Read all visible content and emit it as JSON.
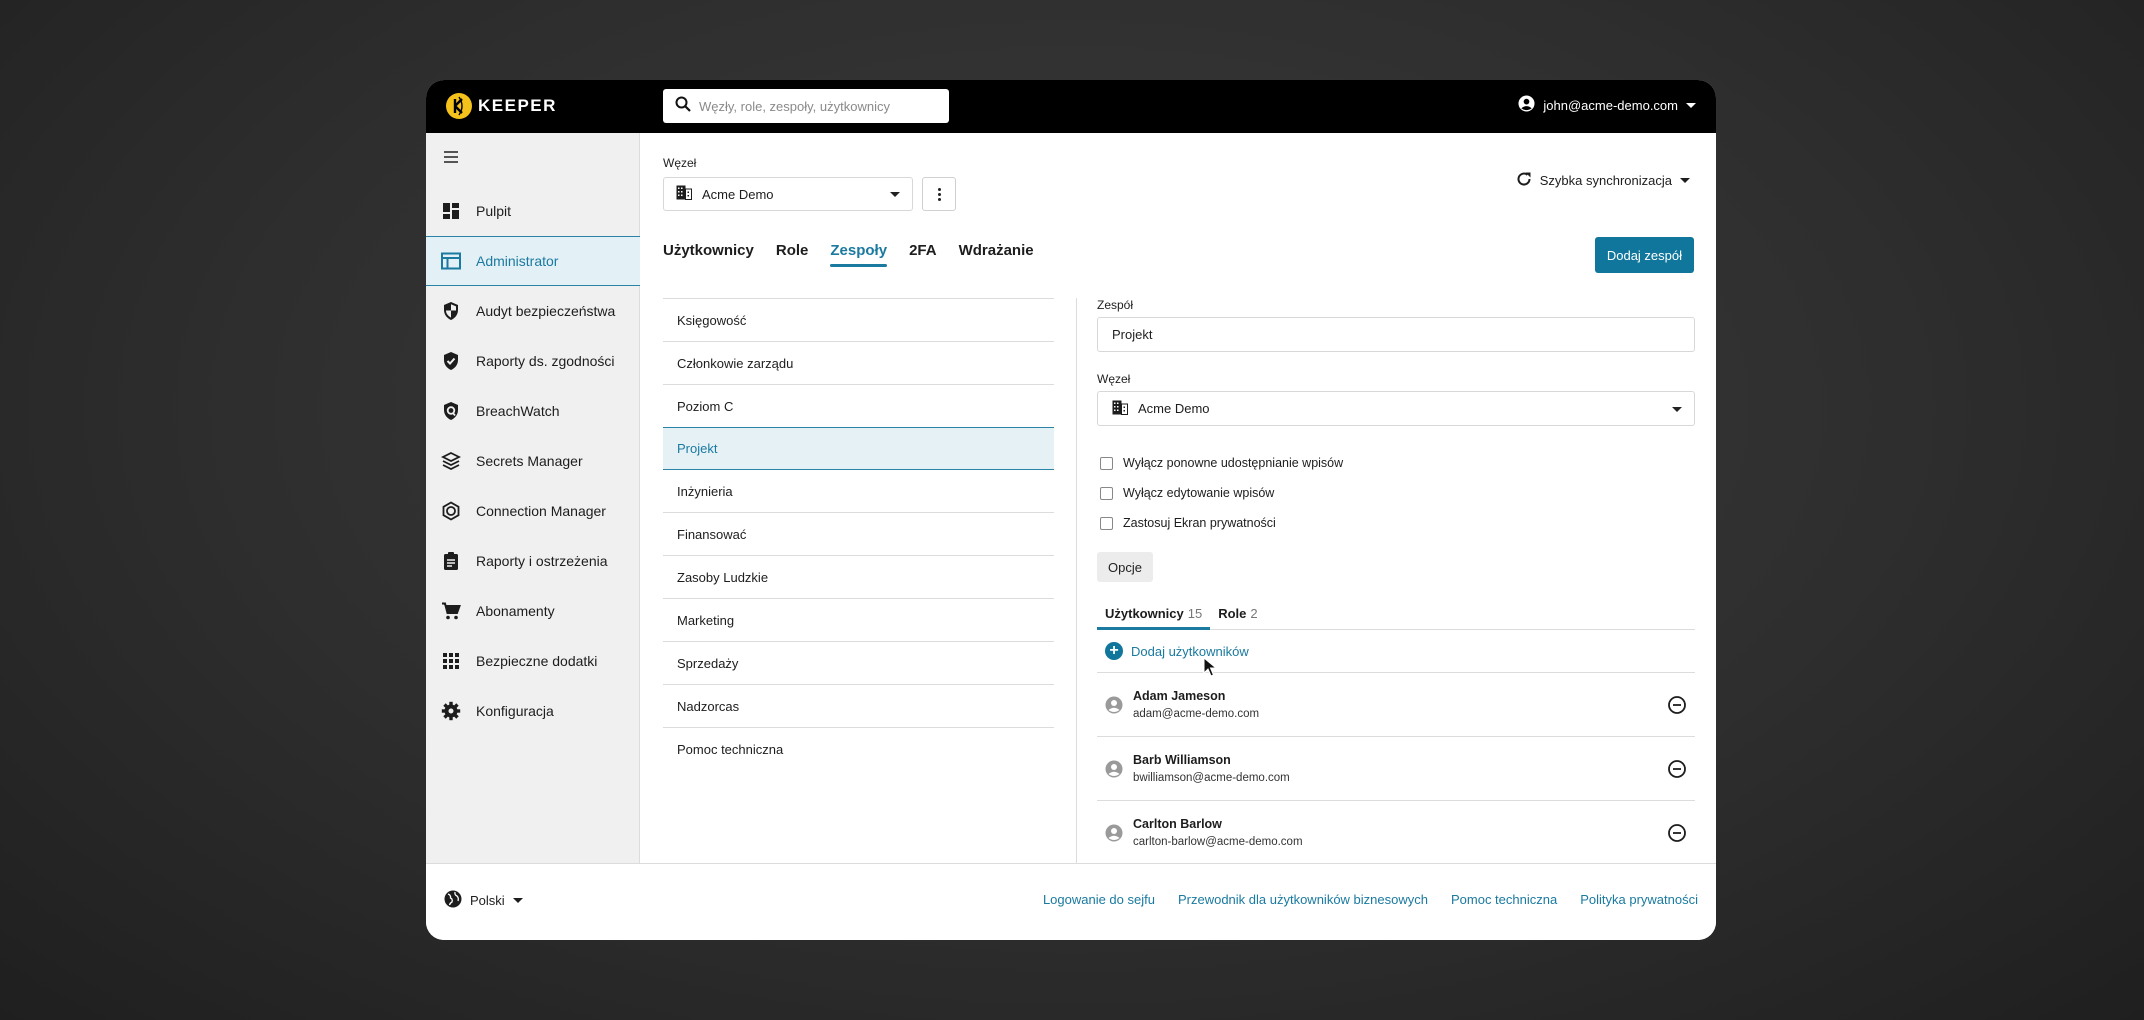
{
  "header": {
    "brand": "KEEPER",
    "search_placeholder": "Węzły, role, zespoły, użytkownicy",
    "user_email": "john@acme-demo.com"
  },
  "sidebar": {
    "items": [
      {
        "label": "Pulpit",
        "icon": "dashboard-icon"
      },
      {
        "label": "Administrator",
        "icon": "admin-console-icon",
        "active": true
      },
      {
        "label": "Audyt bezpieczeństwa",
        "icon": "shield-half-icon"
      },
      {
        "label": "Raporty ds. zgodności",
        "icon": "shield-check-icon"
      },
      {
        "label": "BreachWatch",
        "icon": "breachwatch-icon"
      },
      {
        "label": "Secrets Manager",
        "icon": "layers-icon"
      },
      {
        "label": "Connection Manager",
        "icon": "hexagon-icon"
      },
      {
        "label": "Raporty i ostrzeżenia",
        "icon": "clipboard-icon"
      },
      {
        "label": "Abonamenty",
        "icon": "cart-icon"
      },
      {
        "label": "Bezpieczne dodatki",
        "icon": "grid-icon"
      },
      {
        "label": "Konfiguracja",
        "icon": "gear-icon"
      }
    ]
  },
  "main": {
    "node_label": "Węzeł",
    "node_value": "Acme Demo",
    "sync_label": "Szybka synchronizacja",
    "tabs": [
      {
        "label": "Użytkownicy"
      },
      {
        "label": "Role"
      },
      {
        "label": "Zespoły",
        "active": true
      },
      {
        "label": "2FA"
      },
      {
        "label": "Wdrażanie"
      }
    ],
    "add_team_label": "Dodaj zespół",
    "teams": [
      "Księgowość",
      "Członkowie zarządu",
      "Poziom C",
      "Projekt",
      "Inżynieria",
      "Finansować",
      "Zasoby Ludzkie",
      "Marketing",
      "Sprzedaży",
      "Nadzorcas",
      "Pomoc techniczna"
    ],
    "selected_team": "Projekt"
  },
  "detail": {
    "team_label": "Zespół",
    "team_value": "Projekt",
    "node_label": "Węzeł",
    "node_value": "Acme Demo",
    "checkboxes": [
      {
        "label": "Wyłącz ponowne udostępnianie wpisów",
        "checked": false
      },
      {
        "label": "Wyłącz edytowanie wpisów",
        "checked": false
      },
      {
        "label": "Zastosuj Ekran prywatności",
        "checked": false
      }
    ],
    "options_label": "Opcje",
    "sub_tabs": [
      {
        "label": "Użytkownicy",
        "count": "15",
        "active": true
      },
      {
        "label": "Role",
        "count": "2"
      }
    ],
    "add_users_label": "Dodaj użytkowników",
    "users": [
      {
        "name": "Adam Jameson",
        "email": "adam@acme-demo.com"
      },
      {
        "name": "Barb Williamson",
        "email": "bwilliamson@acme-demo.com"
      },
      {
        "name": "Carlton Barlow",
        "email": "carlton-barlow@acme-demo.com"
      }
    ]
  },
  "footer": {
    "language": "Polski",
    "links": [
      "Logowanie do sejfu",
      "Przewodnik dla użytkowników biznesowych",
      "Pomoc techniczna",
      "Polityka prywatności"
    ]
  },
  "colors": {
    "accent": "#1a7aa0",
    "primary_button": "#10769b",
    "logo_yellow": "#f5c21b",
    "topbar": "#000000"
  }
}
